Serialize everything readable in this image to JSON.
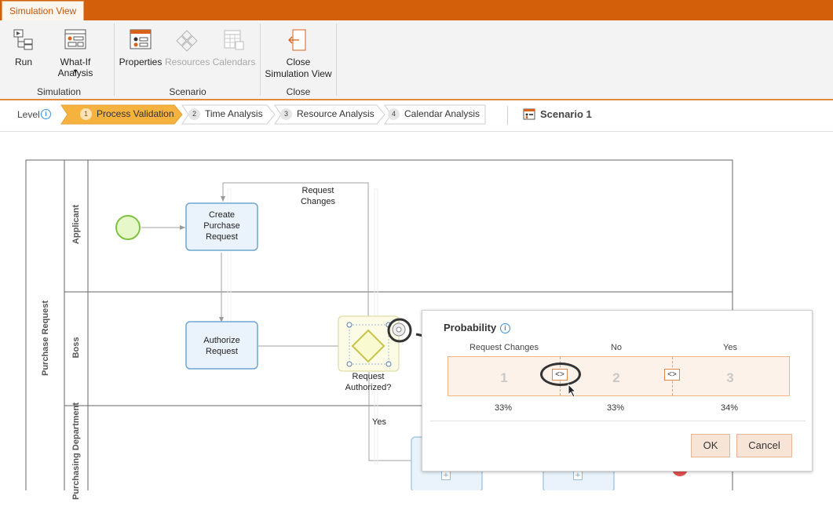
{
  "tab": {
    "label": "Simulation View"
  },
  "ribbon": {
    "groups": [
      {
        "label": "Simulation"
      },
      {
        "label": "Scenario"
      },
      {
        "label": "Close"
      }
    ],
    "buttons": {
      "run": "Run",
      "whatif": "What-If Analysis",
      "whatif_arrow": "▾",
      "properties": "Properties",
      "resources": "Resources",
      "calendars": "Calendars",
      "close_line1": "Close",
      "close_line2": "Simulation View"
    }
  },
  "level": {
    "label": "Level",
    "info": "i",
    "steps": [
      {
        "num": "1",
        "label": "Process Validation"
      },
      {
        "num": "2",
        "label": "Time Analysis"
      },
      {
        "num": "3",
        "label": "Resource Analysis"
      },
      {
        "num": "4",
        "label": "Calendar Analysis"
      }
    ],
    "scenario": "Scenario 1"
  },
  "diagram": {
    "pool": "Purchase Request",
    "lanes": [
      "Applicant",
      "Boss",
      "Purchasing Department"
    ],
    "tasks": {
      "create": [
        "Create",
        "Purchase",
        "Request"
      ],
      "authorize": [
        "Authorize",
        "Request"
      ]
    },
    "gateway": [
      "Request",
      "Authorized?"
    ],
    "flows": {
      "request_changes": [
        "Request",
        "Changes"
      ],
      "yes": "Yes"
    }
  },
  "probability": {
    "title": "Probability",
    "info": "i",
    "columns": [
      {
        "label": "Request Changes",
        "num": "1",
        "pct": "33%"
      },
      {
        "label": "No",
        "num": "2",
        "pct": "33%"
      },
      {
        "label": "Yes",
        "num": "3",
        "pct": "34%"
      }
    ],
    "handle_glyph": "<>",
    "ok": "OK",
    "cancel": "Cancel"
  }
}
